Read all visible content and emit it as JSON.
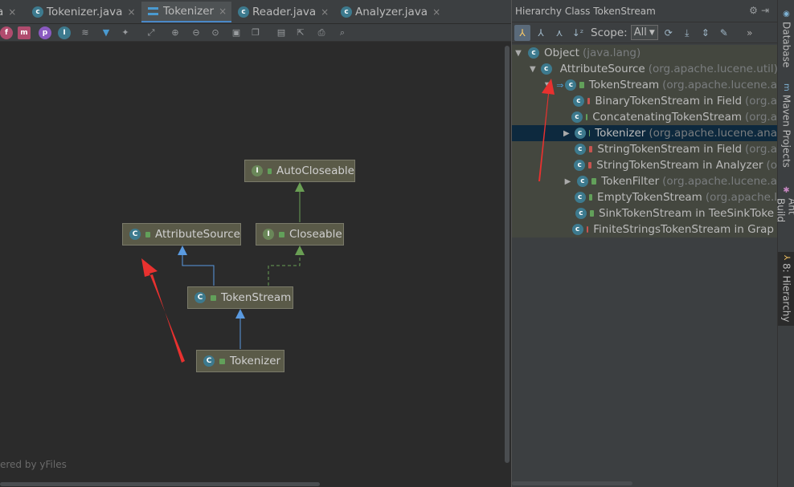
{
  "tabs": [
    {
      "label": "a",
      "icon": "class-icon",
      "active": false
    },
    {
      "label": "Tokenizer.java",
      "icon": "class-icon",
      "active": false
    },
    {
      "label": "Tokenizer",
      "icon": "diagram-icon",
      "active": true
    },
    {
      "label": "Reader.java",
      "icon": "class-icon",
      "active": false
    },
    {
      "label": "Analyzer.java",
      "icon": "class-icon",
      "active": false
    }
  ],
  "tab_close_glyph": "×",
  "diagram": {
    "nodes": {
      "autocloseable": {
        "label": "AutoCloseable",
        "kind": "I"
      },
      "attributesource": {
        "label": "AttributeSource",
        "kind": "C"
      },
      "closeable": {
        "label": "Closeable",
        "kind": "I"
      },
      "tokenstream": {
        "label": "TokenStream",
        "kind": "C"
      },
      "tokenizer": {
        "label": "Tokenizer",
        "kind": "C"
      }
    },
    "watermark": "ered by yFiles"
  },
  "hierarchy": {
    "title": "Hierarchy Class TokenStream",
    "scope_label": "Scope:",
    "scope_value": "All",
    "rows": [
      {
        "arrow": "▼",
        "name": "Object",
        "pkg": "(java.lang)",
        "lock": "none",
        "kind": "C"
      },
      {
        "arrow": "▼",
        "name": "AttributeSource",
        "pkg": "(org.apache.lucene.util)",
        "lock": "green",
        "kind": "C"
      },
      {
        "arrow": "▼",
        "name": "TokenStream",
        "pkg": "(org.apache.lucene.a",
        "lock": "green",
        "kind": "C"
      },
      {
        "arrow": "",
        "name": "BinaryTokenStream in Field",
        "pkg": "(org.a",
        "lock": "red",
        "kind": "C"
      },
      {
        "arrow": "",
        "name": "ConcatenatingTokenStream",
        "pkg": "(org.a",
        "lock": "green",
        "kind": "C"
      },
      {
        "arrow": "▶",
        "name": "Tokenizer",
        "pkg": "(org.apache.lucene.ana",
        "lock": "green",
        "kind": "C"
      },
      {
        "arrow": "",
        "name": "StringTokenStream in Field",
        "pkg": "(org.a",
        "lock": "red",
        "kind": "C"
      },
      {
        "arrow": "",
        "name": "StringTokenStream in Analyzer",
        "pkg": "(o",
        "lock": "red",
        "kind": "C"
      },
      {
        "arrow": "▶",
        "name": "TokenFilter",
        "pkg": "(org.apache.lucene.a",
        "lock": "green",
        "kind": "C"
      },
      {
        "arrow": "",
        "name": "EmptyTokenStream",
        "pkg": "(org.apache.l",
        "lock": "green",
        "kind": "C"
      },
      {
        "arrow": "",
        "name": "SinkTokenStream in TeeSinkToke",
        "pkg": "",
        "lock": "green",
        "kind": "C"
      },
      {
        "arrow": "",
        "name": "FiniteStringsTokenStream in Grap",
        "pkg": "",
        "lock": "red",
        "kind": "C"
      }
    ]
  },
  "side_tabs": [
    {
      "label": "Database"
    },
    {
      "label": "Maven Projects"
    },
    {
      "label": "Ant Build"
    },
    {
      "label": "8: Hierarchy"
    }
  ],
  "colors": {
    "accent": "#4a88c7",
    "selection": "#0d293e",
    "annotation_arrow": "#e8312f"
  }
}
